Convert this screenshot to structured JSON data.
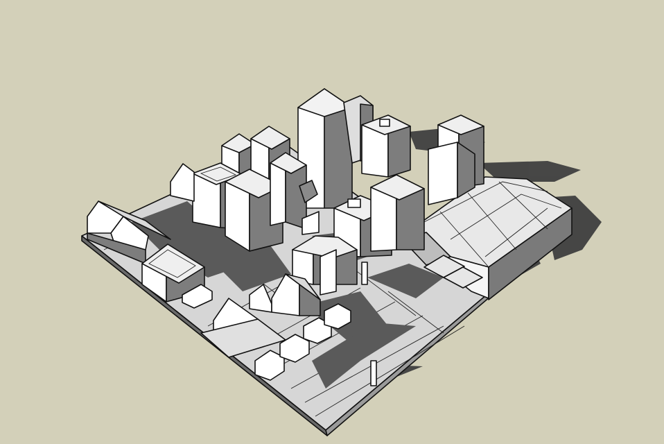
{
  "scene": {
    "description_visible_text": "",
    "render_style": "hidden-line-with-shadows",
    "colors": {
      "background": "#d3d0b9",
      "face_light": "#ffffff",
      "face_mid": "#dcdcdc",
      "face_dark": "#7d7d7d",
      "ground": "#d6d6d6",
      "shadow": "#3f3f3f",
      "edge": "#111111"
    }
  }
}
